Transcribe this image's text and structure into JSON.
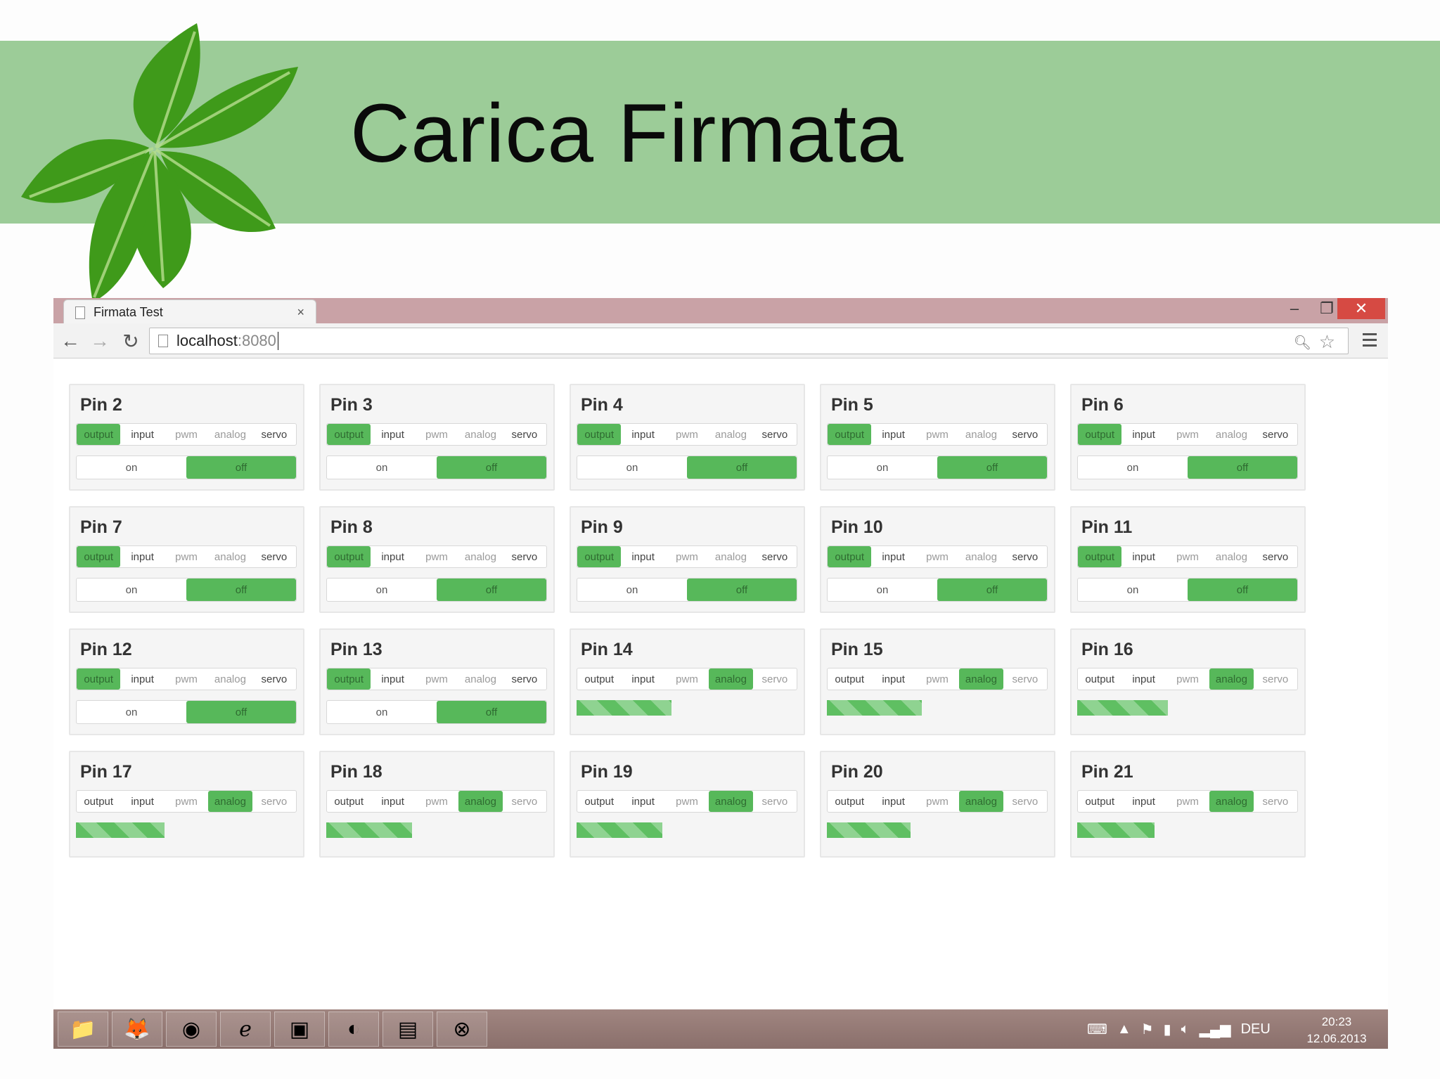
{
  "slide": {
    "title": "Carica Firmata"
  },
  "browser": {
    "tab_title": "Firmata Test",
    "tab_close": "×",
    "url_host": "localhost",
    "url_port": ":8080"
  },
  "pins": [
    {
      "label": "Pin 2",
      "mode": "output",
      "state": "off"
    },
    {
      "label": "Pin 3",
      "mode": "output",
      "state": "off"
    },
    {
      "label": "Pin 4",
      "mode": "output",
      "state": "off"
    },
    {
      "label": "Pin 5",
      "mode": "output",
      "state": "off"
    },
    {
      "label": "Pin 6",
      "mode": "output",
      "state": "off"
    },
    {
      "label": "Pin 7",
      "mode": "output",
      "state": "off"
    },
    {
      "label": "Pin 8",
      "mode": "output",
      "state": "off"
    },
    {
      "label": "Pin 9",
      "mode": "output",
      "state": "off"
    },
    {
      "label": "Pin 10",
      "mode": "output",
      "state": "off"
    },
    {
      "label": "Pin 11",
      "mode": "output",
      "state": "off"
    },
    {
      "label": "Pin 12",
      "mode": "output",
      "state": "off"
    },
    {
      "label": "Pin 13",
      "mode": "output",
      "state": "off"
    },
    {
      "label": "Pin 14",
      "mode": "analog",
      "analog_level": 0.43
    },
    {
      "label": "Pin 15",
      "mode": "analog",
      "analog_level": 0.43
    },
    {
      "label": "Pin 16",
      "mode": "analog",
      "analog_level": 0.41
    },
    {
      "label": "Pin 17",
      "mode": "analog",
      "analog_level": 0.4
    },
    {
      "label": "Pin 18",
      "mode": "analog",
      "analog_level": 0.39
    },
    {
      "label": "Pin 19",
      "mode": "analog",
      "analog_level": 0.39
    },
    {
      "label": "Pin 20",
      "mode": "analog",
      "analog_level": 0.38
    },
    {
      "label": "Pin 21",
      "mode": "analog",
      "analog_level": 0.35
    }
  ],
  "mode_labels": [
    "output",
    "input",
    "pwm",
    "analog",
    "servo"
  ],
  "toggle_labels": {
    "on": "on",
    "off": "off"
  },
  "taskbar": {
    "apps": [
      "explorer-icon",
      "firefox-icon",
      "chrome-icon",
      "internet-explorer-icon",
      "terminal-icon",
      "eclipse-icon",
      "window-icon",
      "xampp-icon"
    ],
    "tray_language": "DEU",
    "clock_time": "20:23",
    "clock_date": "12.06.2013"
  },
  "colors": {
    "header_band": "#9ccc98",
    "active_green": "#57b85a",
    "leaf_green": "#3f9a1a"
  }
}
